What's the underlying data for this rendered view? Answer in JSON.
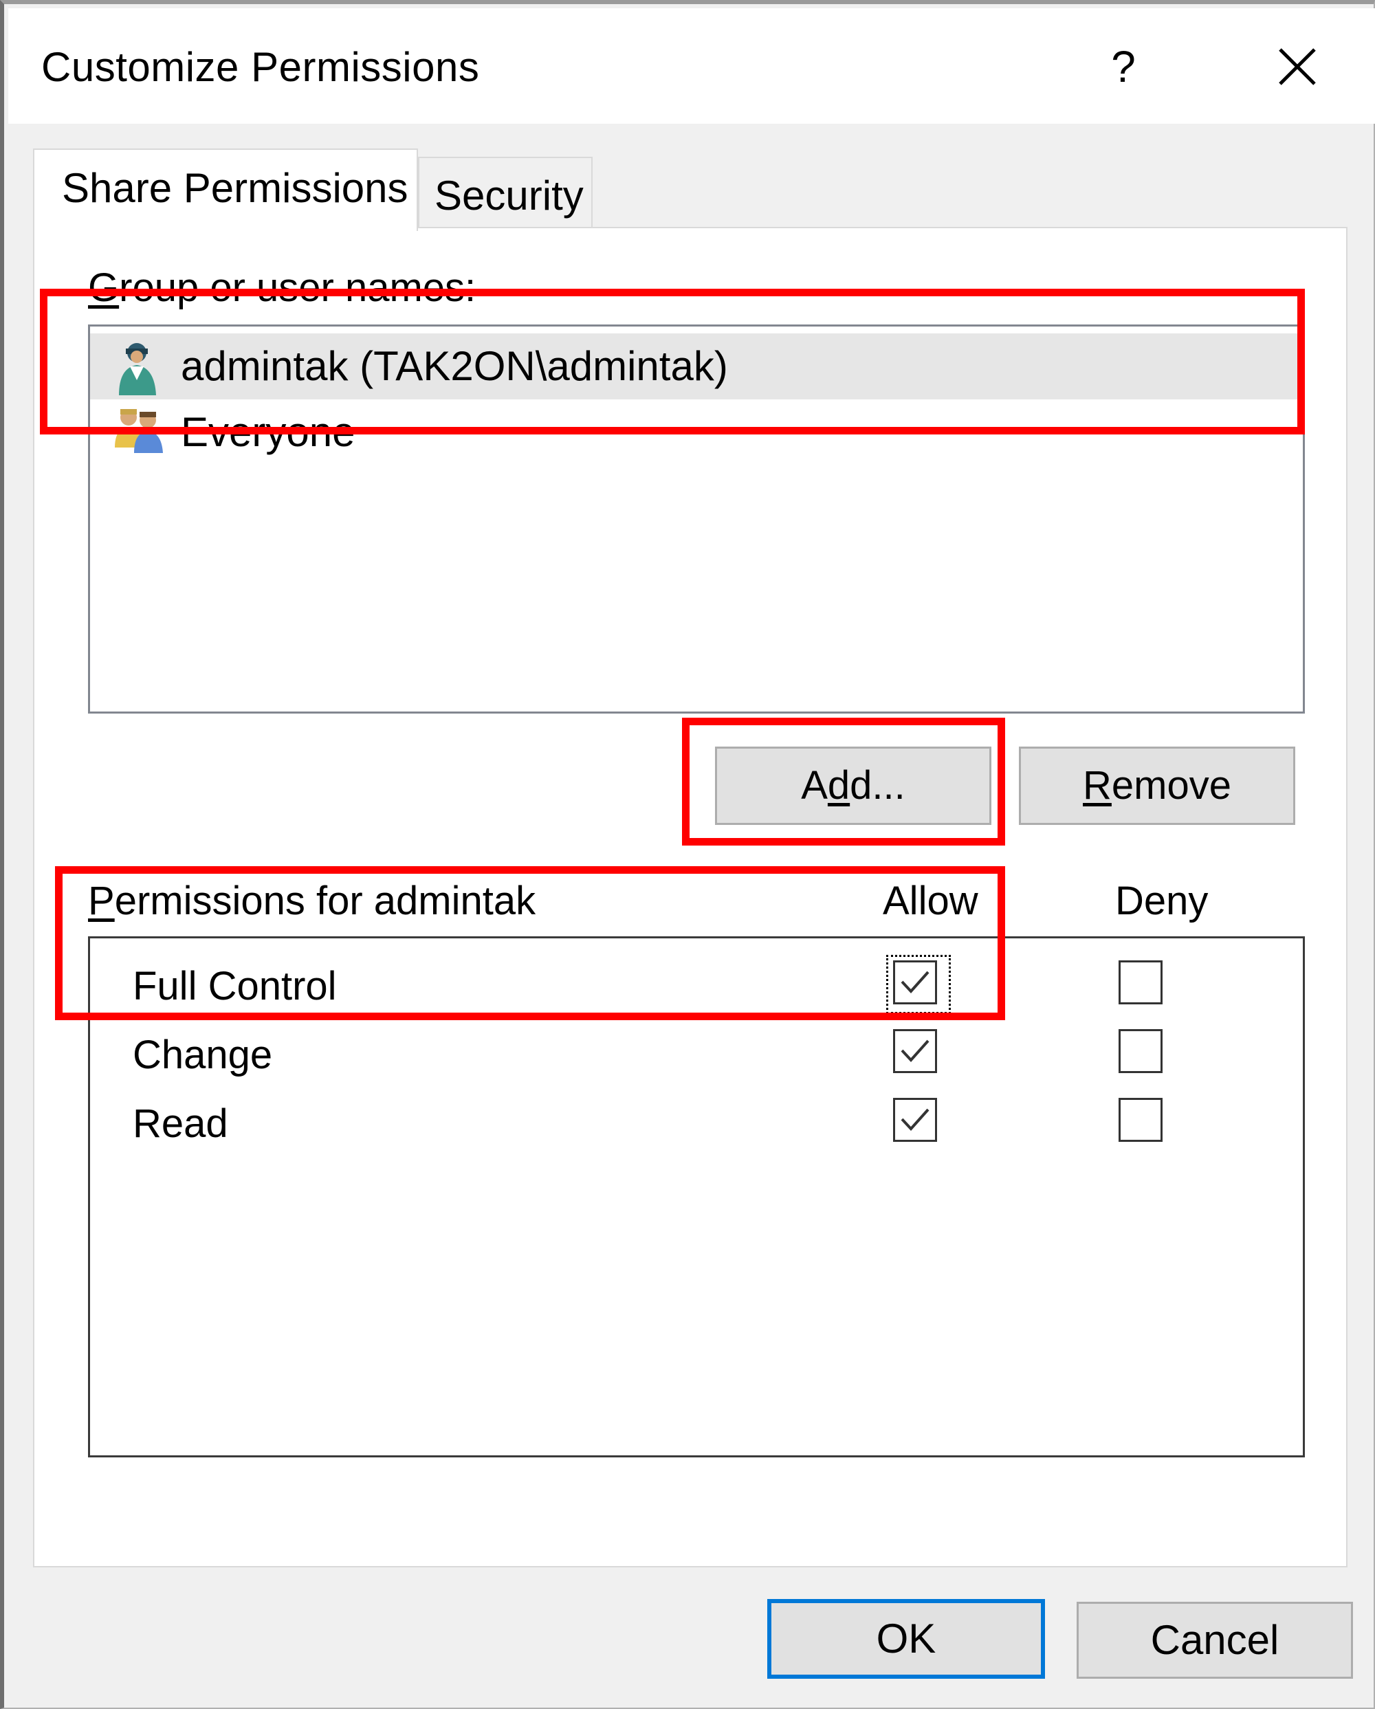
{
  "window": {
    "title": "Customize Permissions",
    "help_glyph": "?",
    "close_icon": "close-icon"
  },
  "tabs": [
    {
      "label": "Share Permissions",
      "active": true
    },
    {
      "label": "Security",
      "active": false
    }
  ],
  "groups": {
    "label_first": "G",
    "label_rest": "roup or user names:",
    "items": [
      {
        "name": "admintak (TAK2ON\\admintak)",
        "icon": "user-icon",
        "selected": true
      },
      {
        "name": "Everyone",
        "icon": "users-group-icon",
        "selected": false
      }
    ]
  },
  "buttons": {
    "add_pre": "A",
    "add_u": "d",
    "add_post": "d...",
    "remove_u": "R",
    "remove_post": "emove",
    "ok": "OK",
    "cancel": "Cancel"
  },
  "permissions": {
    "header_u": "P",
    "header_rest": "ermissions for admintak",
    "allow_label": "Allow",
    "deny_label": "Deny",
    "rows": [
      {
        "name": "Full Control",
        "allow": true,
        "deny": false
      },
      {
        "name": "Change",
        "allow": true,
        "deny": false
      },
      {
        "name": "Read",
        "allow": true,
        "deny": false
      }
    ]
  },
  "colors": {
    "annotation": "#ff0000",
    "default_button_border": "#0078d7",
    "selection": "#e6e6e6"
  }
}
